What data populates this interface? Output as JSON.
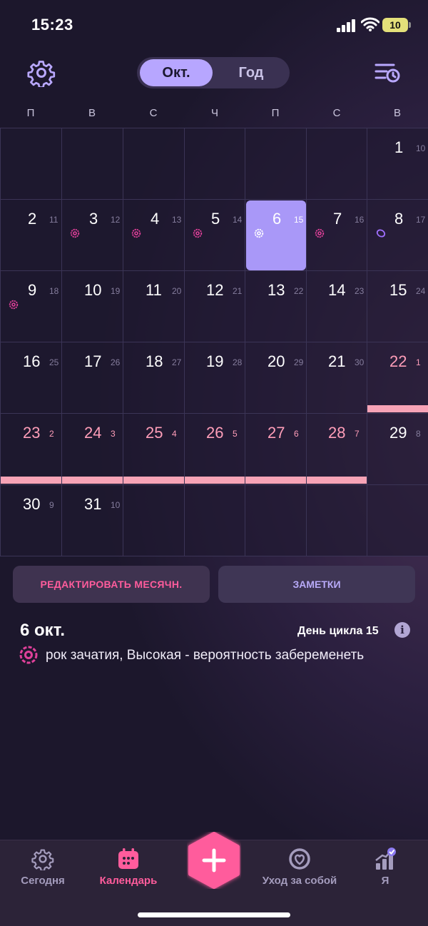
{
  "status_bar": {
    "time": "15:23",
    "battery": "10"
  },
  "header": {
    "month_tab": "Окт.",
    "year_tab": "Год"
  },
  "weekdays": [
    "П",
    "В",
    "С",
    "Ч",
    "П",
    "С",
    "В"
  ],
  "calendar": {
    "weeks": [
      [
        null,
        null,
        null,
        null,
        null,
        null,
        {
          "day": "1",
          "cycle": "10"
        }
      ],
      [
        {
          "day": "2",
          "cycle": "11"
        },
        {
          "day": "3",
          "cycle": "12",
          "fertile": true
        },
        {
          "day": "4",
          "cycle": "13",
          "fertile": true
        },
        {
          "day": "5",
          "cycle": "14",
          "fertile": true
        },
        {
          "day": "6",
          "cycle": "15",
          "fertile": true,
          "today": true
        },
        {
          "day": "7",
          "cycle": "16",
          "fertile": true
        },
        {
          "day": "8",
          "cycle": "17",
          "ovulation": true
        }
      ],
      [
        {
          "day": "9",
          "cycle": "18",
          "fertile": true
        },
        {
          "day": "10",
          "cycle": "19"
        },
        {
          "day": "11",
          "cycle": "20"
        },
        {
          "day": "12",
          "cycle": "21"
        },
        {
          "day": "13",
          "cycle": "22"
        },
        {
          "day": "14",
          "cycle": "23"
        },
        {
          "day": "15",
          "cycle": "24"
        }
      ],
      [
        {
          "day": "16",
          "cycle": "25"
        },
        {
          "day": "17",
          "cycle": "26"
        },
        {
          "day": "18",
          "cycle": "27"
        },
        {
          "day": "19",
          "cycle": "28"
        },
        {
          "day": "20",
          "cycle": "29"
        },
        {
          "day": "21",
          "cycle": "30"
        },
        {
          "day": "22",
          "cycle": "1",
          "period": true
        }
      ],
      [
        {
          "day": "23",
          "cycle": "2",
          "period": true
        },
        {
          "day": "24",
          "cycle": "3",
          "period": true
        },
        {
          "day": "25",
          "cycle": "4",
          "period": true
        },
        {
          "day": "26",
          "cycle": "5",
          "period": true
        },
        {
          "day": "27",
          "cycle": "6",
          "period": true
        },
        {
          "day": "28",
          "cycle": "7",
          "period": true
        },
        {
          "day": "29",
          "cycle": "8"
        }
      ],
      [
        {
          "day": "30",
          "cycle": "9"
        },
        {
          "day": "31",
          "cycle": "10"
        },
        null,
        null,
        null,
        null,
        null
      ]
    ]
  },
  "actions": {
    "edit_period": "РЕДАКТИРОВАТЬ МЕСЯЧН.",
    "notes": "ЗАМЕТКИ"
  },
  "selected": {
    "date": "6 окт.",
    "cycle_day": "День цикла 15",
    "info": "i",
    "description": "рок зачатия, Высокая - вероятность забеременеть"
  },
  "nav": {
    "today": "Сегодня",
    "calendar": "Календарь",
    "care": "Уход за собой",
    "me": "Я"
  },
  "colors": {
    "accent_pink": "#ff5c9c",
    "period_bar": "#f7a3b6",
    "selected_day": "#a998f8",
    "ovulation": "#a070ff"
  }
}
